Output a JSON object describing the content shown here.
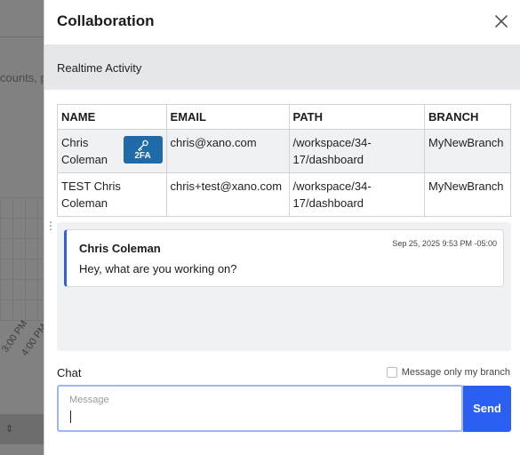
{
  "background": {
    "partial_text": "counts, p",
    "axis_ticks": [
      "3:00 PM",
      "4:00 PM"
    ]
  },
  "panel": {
    "title": "Collaboration",
    "close_icon": "close-icon",
    "section_title": "Realtime Activity"
  },
  "table": {
    "headers": [
      "NAME",
      "EMAIL",
      "PATH",
      "BRANCH"
    ],
    "rows": [
      {
        "name": "Chris Coleman",
        "badge": "2FA",
        "email": "chris@xano.com",
        "path": "/workspace/34-17/dashboard",
        "branch": "MyNewBranch"
      },
      {
        "name": "TEST Chris Coleman",
        "email": "chris+test@xano.com",
        "path": "/workspace/34-17/dashboard",
        "branch": "MyNewBranch"
      }
    ]
  },
  "messages": [
    {
      "author": "Chris Coleman",
      "timestamp": "Sep 25, 2025 9:53 PM -05:00",
      "text": "Hey, what are you working on?"
    }
  ],
  "composer": {
    "label": "Chat",
    "branch_only_label": "Message only my branch",
    "branch_only_checked": false,
    "placeholder": "Message",
    "value": "",
    "send_label": "Send"
  },
  "colors": {
    "accent": "#2b5ff2",
    "message_border": "#2f5fdb",
    "badge": "#1f6aa8",
    "section_bar": "#e5e7ea"
  }
}
